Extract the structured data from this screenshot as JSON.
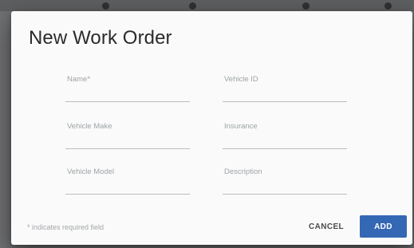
{
  "dialog": {
    "title": "New Work Order",
    "fields": {
      "name": {
        "label": "Name*",
        "value": ""
      },
      "vehicle_id": {
        "label": "Vehicle ID",
        "value": ""
      },
      "vehicle_make": {
        "label": "Vehicle Make",
        "value": ""
      },
      "insurance": {
        "label": "Insurance",
        "value": ""
      },
      "vehicle_model": {
        "label": "Vehicle Model",
        "value": ""
      },
      "description": {
        "label": "Description",
        "value": ""
      }
    },
    "required_note": "* indicates required field",
    "buttons": {
      "cancel": "CANCEL",
      "add": "ADD"
    }
  },
  "colors": {
    "primary": "#3568b4",
    "backdrop": "#6f7072"
  }
}
